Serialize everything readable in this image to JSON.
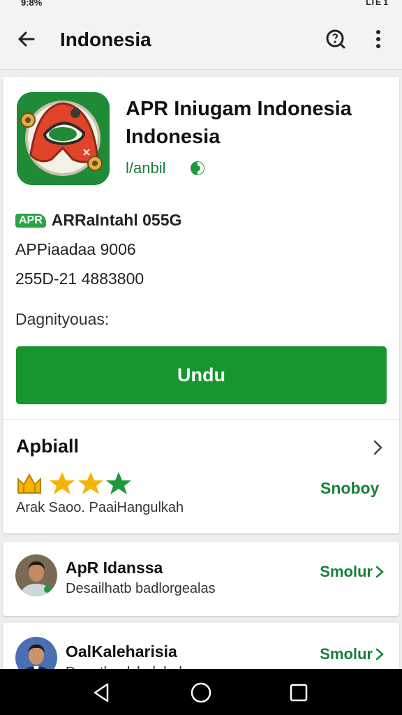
{
  "status_bar": {
    "time": "9:8%",
    "right_text": "LTE 1"
  },
  "app_bar": {
    "title": "Indonesia",
    "back_icon": "arrow-back-icon",
    "search_icon": "search-icon",
    "more_icon": "more-vert-icon"
  },
  "app": {
    "name": "APR Iniugam Indonesia Indonesia",
    "developer": "l/anbil",
    "badge_icon": "verified-icon",
    "apk_badge": "APR",
    "meta_line_1": "ARRaIntahl 055G",
    "meta_line_2": "APPiaadaa 9006",
    "meta_line_3": "255D-21 4883800",
    "description_label": "Dagnityouas:",
    "download_label": "Undu"
  },
  "rating": {
    "title": "Apbiall",
    "see_all": "Snoboy",
    "subtitle": "Arak Saoo. PaaiHangulkah",
    "stars": 3
  },
  "reviews": [
    {
      "name": "ApR Idanssa",
      "subtitle": "Desailhatb badlorgealas",
      "action": "Smolur"
    },
    {
      "name": "OalKaleharisia",
      "subtitle": "Drmathaalsbalahaha",
      "action": "Smolur"
    }
  ],
  "colors": {
    "accent": "#17952f",
    "link": "#188038",
    "star": "#f4b400",
    "star_last": "#1f9a3a"
  }
}
